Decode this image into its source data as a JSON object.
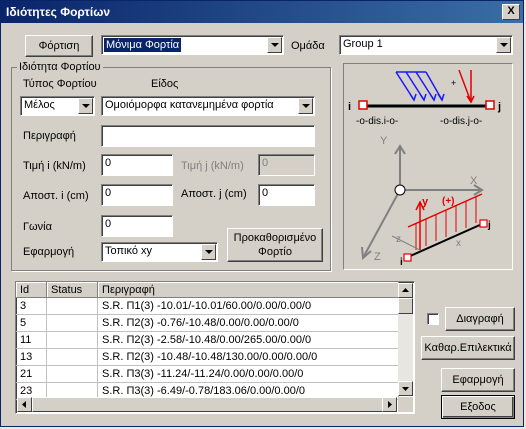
{
  "window": {
    "title": "Ιδιότητες Φορτίων",
    "close": "X"
  },
  "top": {
    "load_button": "Φόρτιση",
    "load_value": "Μόνιμα Φορτία",
    "group_label": "Ομάδα",
    "group_value": "Group 1"
  },
  "props": {
    "group_title": "Ιδιότητα Φορτίου",
    "load_type_label": "Τύπος Φορτίου",
    "kind_label": "Είδος",
    "load_type_value": "Μέλος",
    "kind_value": "Ομοιόμορφα κατανεμημένα φορτία",
    "description_label": "Περιγραφή",
    "description_value": "",
    "value_i_label": "Τιμή i (kN/m)",
    "value_i": "0",
    "value_j_label": "Τιμή j (kN/m)",
    "value_j": "0",
    "dist_i_label": "Αποστ. i (cm)",
    "dist_i": "0",
    "dist_j_label": "Αποστ. j (cm)",
    "dist_j": "0",
    "angle_label": "Γωνία",
    "angle": "0",
    "apply_label": "Εφαρμογή",
    "apply_value": "Τοπικό xy",
    "predefined_button": "Προκαθορισμένο Φορτίο"
  },
  "diagram": {
    "node_i": "i",
    "node_j": "j",
    "dis_i": "-o-dis.i-o-",
    "dis_j": "-o-dis.j-o-",
    "axis_Y": "Y",
    "axis_X": "X",
    "axis_Z": "Z",
    "local_y": "y",
    "local_x": "x",
    "local_z": "z",
    "plus": "(+)",
    "end_j": "j",
    "end_i": "i",
    "colors": {
      "blue": "#1a1aff",
      "red": "#e00000"
    }
  },
  "table": {
    "columns": [
      "Id",
      "Status",
      "Περιγραφή"
    ],
    "rows": [
      [
        "3",
        "",
        "S.R. Π1(3) -10.01/-10.01/60.00/0.00/0.00/0"
      ],
      [
        "5",
        "",
        "S.R. Π2(3) -0.76/-10.48/0.00/0.00/0.00/0"
      ],
      [
        "11",
        "",
        "S.R. Π2(3) -2.58/-10.48/0.00/265.00/0.00/0"
      ],
      [
        "13",
        "",
        "S.R. Π2(3) -10.48/-10.48/130.00/0.00/0.00/0"
      ],
      [
        "21",
        "",
        "S.R. Π3(3) -11.24/-11.24/0.00/0.00/0.00/0"
      ],
      [
        "23",
        "",
        "S.R. Π3(3) -6.49/-0.78/183.06/0.00/0.00/0"
      ]
    ]
  },
  "actions": {
    "delete": "Διαγραφή",
    "clear_selected": "Καθαρ.Επιλεκτικά",
    "apply": "Εφαρμογή",
    "exit": "Εξοδος"
  }
}
